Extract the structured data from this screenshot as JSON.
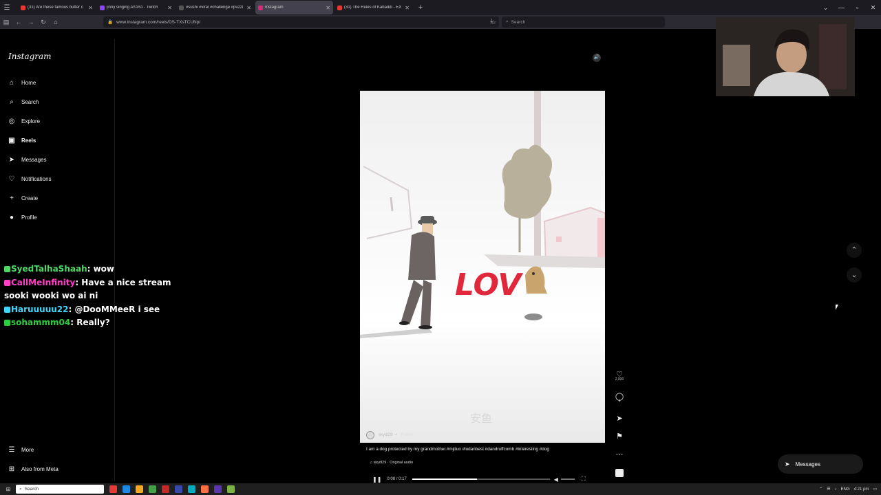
{
  "browser": {
    "tabs": [
      {
        "title": "(31) Are these famous butter c",
        "color": "#e53935",
        "active": false
      },
      {
        "title": "jinny singing AYAYA - Twitch",
        "color": "#9146ff",
        "active": false
      },
      {
        "title": "#sushi #viral #challenge #puzzl",
        "color": "#555555",
        "active": false
      },
      {
        "title": "Instagram",
        "color": "#d62976",
        "active": true
      },
      {
        "title": "(31) The Rules of Kabaddi - EX",
        "color": "#e53935",
        "active": false
      }
    ],
    "url": "www.instagram.com/reels/DS-TXsTCUNp/",
    "search_placeholder": "Search"
  },
  "instagram": {
    "logo": "Instagram",
    "nav": [
      {
        "label": "Home",
        "icon": "home-icon",
        "glyph": "⌂"
      },
      {
        "label": "Search",
        "icon": "search-icon",
        "glyph": "⌕"
      },
      {
        "label": "Explore",
        "icon": "compass-icon",
        "glyph": "◎"
      },
      {
        "label": "Reels",
        "icon": "reels-icon",
        "glyph": "▣"
      },
      {
        "label": "Messages",
        "icon": "send-icon",
        "glyph": "➤"
      },
      {
        "label": "Notifications",
        "icon": "heart-icon",
        "glyph": "♡"
      },
      {
        "label": "Create",
        "icon": "plus-icon",
        "glyph": "+"
      },
      {
        "label": "Profile",
        "icon": "avatar-icon",
        "glyph": "●"
      }
    ],
    "more": "More",
    "also_from_meta": "Also from Meta",
    "reel": {
      "video_text": "LOV",
      "watermark": "安鱼",
      "username": "skydl29",
      "follow": "Follow",
      "caption": "I am a dog protected by my grandmother.#mjduo #ludanbest #dandruffcomb #interesting #dog",
      "audio": "skydl29 · Original audio",
      "time": "0:08 / 0:17",
      "progress": 0.47,
      "likes": "2,000",
      "comments": "1"
    },
    "messages_button": "Messages"
  },
  "chat": [
    {
      "user": "SyedTalhaShaah",
      "color": "#4cd964",
      "text": ": wow"
    },
    {
      "user": "CallMeInfinity",
      "color": "#ff3ec8",
      "text": ": Have a nice stream sooki wooki wo ai ni"
    },
    {
      "user": "Haruuuuu22",
      "color": "#3ed8ff",
      "text": ": @DooMMeeR i see"
    },
    {
      "user": "sohammm04",
      "color": "#2ecc40",
      "text": ": Really?"
    }
  ],
  "taskbar": {
    "search": "Search",
    "lang": "ENG",
    "time": "4:21 pm"
  }
}
